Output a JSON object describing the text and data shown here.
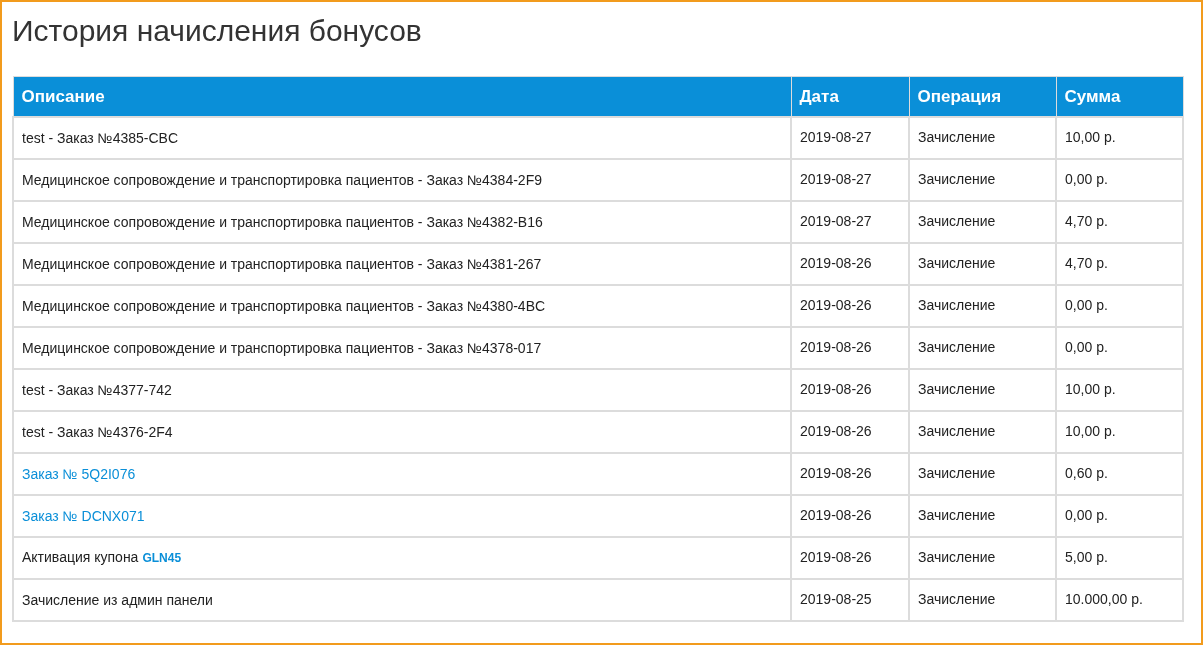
{
  "title": "История начисления бонусов",
  "table": {
    "columns": [
      "Описание",
      "Дата",
      "Операция",
      "Сумма"
    ],
    "rows": [
      {
        "description": {
          "kind": "plain",
          "text": "test - Заказ №4385-CBC"
        },
        "date": "2019-08-27",
        "operation": "Зачисление",
        "amount": "10,00 р."
      },
      {
        "description": {
          "kind": "plain",
          "text": "Медицинское сопровождение и транспортировка пациентов - Заказ №4384-2F9"
        },
        "date": "2019-08-27",
        "operation": "Зачисление",
        "amount": "0,00 р."
      },
      {
        "description": {
          "kind": "plain",
          "text": "Медицинское сопровождение и транспортировка пациентов - Заказ №4382-B16"
        },
        "date": "2019-08-27",
        "operation": "Зачисление",
        "amount": "4,70 р."
      },
      {
        "description": {
          "kind": "plain",
          "text": "Медицинское сопровождение и транспортировка пациентов - Заказ №4381-267"
        },
        "date": "2019-08-26",
        "operation": "Зачисление",
        "amount": "4,70 р."
      },
      {
        "description": {
          "kind": "plain",
          "text": "Медицинское сопровождение и транспортировка пациентов - Заказ №4380-4BC"
        },
        "date": "2019-08-26",
        "operation": "Зачисление",
        "amount": "0,00 р."
      },
      {
        "description": {
          "kind": "plain",
          "text": "Медицинское сопровождение и транспортировка пациентов - Заказ №4378-017"
        },
        "date": "2019-08-26",
        "operation": "Зачисление",
        "amount": "0,00 р."
      },
      {
        "description": {
          "kind": "plain",
          "text": "test - Заказ №4377-742"
        },
        "date": "2019-08-26",
        "operation": "Зачисление",
        "amount": "10,00 р."
      },
      {
        "description": {
          "kind": "plain",
          "text": "test - Заказ №4376-2F4"
        },
        "date": "2019-08-26",
        "operation": "Зачисление",
        "amount": "10,00 р."
      },
      {
        "description": {
          "kind": "link",
          "text": "Заказ № 5Q2I076"
        },
        "date": "2019-08-26",
        "operation": "Зачисление",
        "amount": "0,60 р."
      },
      {
        "description": {
          "kind": "link",
          "text": "Заказ № DCNX071"
        },
        "date": "2019-08-26",
        "operation": "Зачисление",
        "amount": "0,00 р."
      },
      {
        "description": {
          "kind": "coupon",
          "text": "Активация купона",
          "code": "GLN45"
        },
        "date": "2019-08-26",
        "operation": "Зачисление",
        "amount": "5,00 р."
      },
      {
        "description": {
          "kind": "plain",
          "text": "Зачисление из админ панели"
        },
        "date": "2019-08-25",
        "operation": "Зачисление",
        "amount": "10.000,00 р."
      }
    ]
  }
}
